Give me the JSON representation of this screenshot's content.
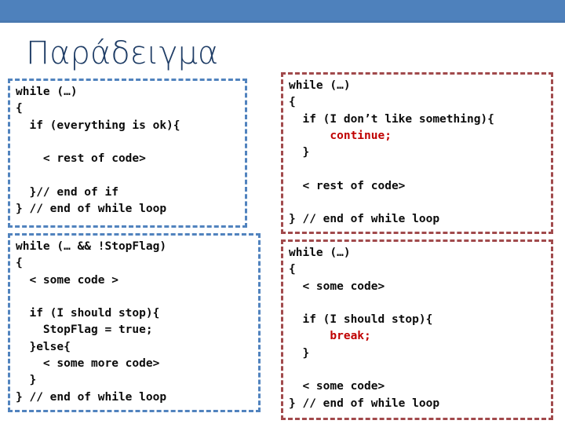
{
  "slide": {
    "title": "Παράδειγμα",
    "header_color": "#4E81BC",
    "title_color": "#1F3D66",
    "accent_blue": "#5183BE",
    "accent_red": "#A14A4C",
    "keyword_color": "#C00000"
  },
  "code_blocks": {
    "top_left": {
      "border_color": "#5183BE",
      "lines": [
        "while (…)",
        "{",
        "  if (everything is ok){",
        "",
        "    < rest of code>",
        "",
        "  }// end of if",
        "} // end of while loop"
      ]
    },
    "top_right": {
      "border_color": "#A14A4C",
      "lines": [
        {
          "text": "while (…)"
        },
        {
          "text": "{"
        },
        {
          "text": "  if (I don’t like something){"
        },
        {
          "pre": "      ",
          "keyword": "continue",
          "post": ";"
        },
        {
          "text": "  }"
        },
        {
          "text": ""
        },
        {
          "text": "  < rest of code>"
        },
        {
          "text": ""
        },
        {
          "text": "} // end of while loop"
        }
      ]
    },
    "bottom_left": {
      "border_color": "#5183BE",
      "lines": [
        "while (… && !StopFlag)",
        "{",
        "  < some code >",
        "",
        "  if (I should stop){",
        "    StopFlag = true;",
        "  }else{",
        "    < some more code>",
        "  }",
        "} // end of while loop"
      ]
    },
    "bottom_right": {
      "border_color": "#A14A4C",
      "lines": [
        {
          "text": "while (…)"
        },
        {
          "text": "{"
        },
        {
          "text": "  < some code>"
        },
        {
          "text": ""
        },
        {
          "text": "  if (I should stop){"
        },
        {
          "pre": "      ",
          "keyword": "break",
          "post": ";"
        },
        {
          "text": "  }"
        },
        {
          "text": ""
        },
        {
          "text": "  < some code>"
        },
        {
          "text": "} // end of while loop"
        }
      ]
    }
  }
}
